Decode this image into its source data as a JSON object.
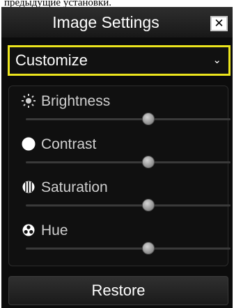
{
  "caption": "предыдущие установки.",
  "dialog": {
    "title": "Image Settings",
    "close_glyph": "✕"
  },
  "mode": {
    "value": "Customize",
    "chevron": "⌄"
  },
  "adjustments": [
    {
      "label": "Brightness",
      "icon": "sun-icon",
      "level": 0.6
    },
    {
      "label": "Contrast",
      "icon": "contrast-icon",
      "level": 0.6
    },
    {
      "label": "Saturation",
      "icon": "saturation-icon",
      "level": 0.6
    },
    {
      "label": "Hue",
      "icon": "hue-icon",
      "level": 0.6
    }
  ],
  "restore_label": "Restore",
  "colors": {
    "panel_bg": "#0c0c0c",
    "select_border": "#ece51d",
    "label_text": "#cfcfcf"
  }
}
